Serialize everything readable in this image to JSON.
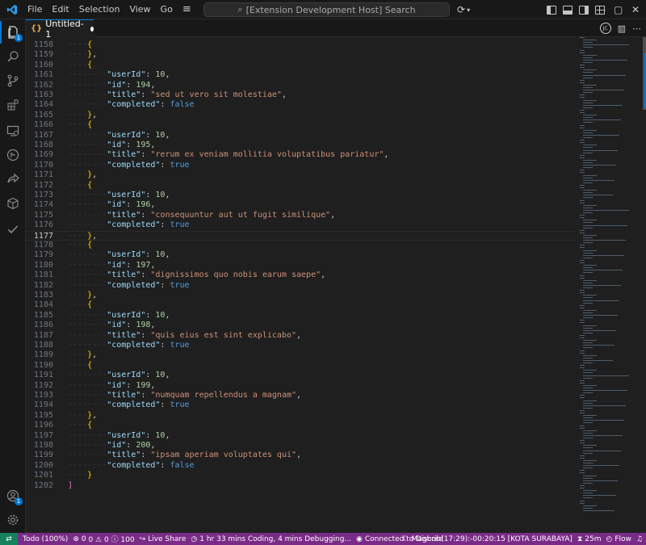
{
  "titlebar": {
    "menu": [
      "File",
      "Edit",
      "Selection",
      "View",
      "Go"
    ],
    "command_center": "[Extension Development Host] Search"
  },
  "activity_bar": {
    "items": [
      "explorer-icon",
      "search-icon",
      "source-control-icon",
      "extensions-icon",
      "remote-explorer-icon",
      "github-icon",
      "live-share-icon",
      "package-icon",
      "todo-check-icon"
    ],
    "explorer_badge": "1",
    "accounts_badge": "1"
  },
  "tab": {
    "label": "Untitled-1",
    "avatar_initials": "JC"
  },
  "editor": {
    "current_line": 1177,
    "lines": [
      {
        "n": "1158",
        "indent": 1,
        "tokens": [
          [
            "b2",
            "{"
          ]
        ]
      },
      {
        "n": "1159",
        "indent": 1,
        "tokens": [
          [
            "b2",
            "}"
          ],
          [
            "punc",
            ","
          ]
        ]
      },
      {
        "n": "1160",
        "indent": 1,
        "tokens": [
          [
            "b2",
            "{"
          ]
        ]
      },
      {
        "n": "1161",
        "indent": 2,
        "tokens": [
          [
            "key",
            "\"userId\""
          ],
          [
            "punc",
            ": "
          ],
          [
            "num",
            "10"
          ],
          [
            "punc",
            ","
          ]
        ]
      },
      {
        "n": "1162",
        "indent": 2,
        "tokens": [
          [
            "key",
            "\"id\""
          ],
          [
            "punc",
            ": "
          ],
          [
            "num",
            "194"
          ],
          [
            "punc",
            ","
          ]
        ]
      },
      {
        "n": "1163",
        "indent": 2,
        "tokens": [
          [
            "key",
            "\"title\""
          ],
          [
            "punc",
            ": "
          ],
          [
            "str",
            "\"sed ut vero sit molestiae\""
          ],
          [
            "punc",
            ","
          ]
        ]
      },
      {
        "n": "1164",
        "indent": 2,
        "tokens": [
          [
            "key",
            "\"completed\""
          ],
          [
            "punc",
            ": "
          ],
          [
            "kw",
            "false"
          ]
        ]
      },
      {
        "n": "1165",
        "indent": 1,
        "tokens": [
          [
            "b2",
            "}"
          ],
          [
            "punc",
            ","
          ]
        ]
      },
      {
        "n": "1166",
        "indent": 1,
        "tokens": [
          [
            "b2",
            "{"
          ]
        ]
      },
      {
        "n": "1167",
        "indent": 2,
        "tokens": [
          [
            "key",
            "\"userId\""
          ],
          [
            "punc",
            ": "
          ],
          [
            "num",
            "10"
          ],
          [
            "punc",
            ","
          ]
        ]
      },
      {
        "n": "1168",
        "indent": 2,
        "tokens": [
          [
            "key",
            "\"id\""
          ],
          [
            "punc",
            ": "
          ],
          [
            "num",
            "195"
          ],
          [
            "punc",
            ","
          ]
        ]
      },
      {
        "n": "1169",
        "indent": 2,
        "tokens": [
          [
            "key",
            "\"title\""
          ],
          [
            "punc",
            ": "
          ],
          [
            "str",
            "\"rerum ex veniam mollitia voluptatibus pariatur\""
          ],
          [
            "punc",
            ","
          ]
        ]
      },
      {
        "n": "1170",
        "indent": 2,
        "tokens": [
          [
            "key",
            "\"completed\""
          ],
          [
            "punc",
            ": "
          ],
          [
            "kw",
            "true"
          ]
        ]
      },
      {
        "n": "1171",
        "indent": 1,
        "tokens": [
          [
            "b2",
            "}"
          ],
          [
            "punc",
            ","
          ]
        ]
      },
      {
        "n": "1172",
        "indent": 1,
        "tokens": [
          [
            "b2",
            "{"
          ]
        ]
      },
      {
        "n": "1173",
        "indent": 2,
        "tokens": [
          [
            "key",
            "\"userId\""
          ],
          [
            "punc",
            ": "
          ],
          [
            "num",
            "10"
          ],
          [
            "punc",
            ","
          ]
        ]
      },
      {
        "n": "1174",
        "indent": 2,
        "tokens": [
          [
            "key",
            "\"id\""
          ],
          [
            "punc",
            ": "
          ],
          [
            "num",
            "196"
          ],
          [
            "punc",
            ","
          ]
        ]
      },
      {
        "n": "1175",
        "indent": 2,
        "tokens": [
          [
            "key",
            "\"title\""
          ],
          [
            "punc",
            ": "
          ],
          [
            "str",
            "\"consequuntur aut ut fugit similique\""
          ],
          [
            "punc",
            ","
          ]
        ]
      },
      {
        "n": "1176",
        "indent": 2,
        "tokens": [
          [
            "key",
            "\"completed\""
          ],
          [
            "punc",
            ": "
          ],
          [
            "kw",
            "true"
          ]
        ]
      },
      {
        "n": "1177",
        "indent": 1,
        "tokens": [
          [
            "b2",
            "}"
          ],
          [
            "punc",
            ","
          ]
        ]
      },
      {
        "n": "1178",
        "indent": 1,
        "tokens": [
          [
            "b2",
            "{"
          ]
        ]
      },
      {
        "n": "1179",
        "indent": 2,
        "tokens": [
          [
            "key",
            "\"userId\""
          ],
          [
            "punc",
            ": "
          ],
          [
            "num",
            "10"
          ],
          [
            "punc",
            ","
          ]
        ]
      },
      {
        "n": "1180",
        "indent": 2,
        "tokens": [
          [
            "key",
            "\"id\""
          ],
          [
            "punc",
            ": "
          ],
          [
            "num",
            "197"
          ],
          [
            "punc",
            ","
          ]
        ]
      },
      {
        "n": "1181",
        "indent": 2,
        "tokens": [
          [
            "key",
            "\"title\""
          ],
          [
            "punc",
            ": "
          ],
          [
            "str",
            "\"dignissimos quo nobis earum saepe\""
          ],
          [
            "punc",
            ","
          ]
        ]
      },
      {
        "n": "1182",
        "indent": 2,
        "tokens": [
          [
            "key",
            "\"completed\""
          ],
          [
            "punc",
            ": "
          ],
          [
            "kw",
            "true"
          ]
        ]
      },
      {
        "n": "1183",
        "indent": 1,
        "tokens": [
          [
            "b2",
            "}"
          ],
          [
            "punc",
            ","
          ]
        ]
      },
      {
        "n": "1184",
        "indent": 1,
        "tokens": [
          [
            "b2",
            "{"
          ]
        ]
      },
      {
        "n": "1185",
        "indent": 2,
        "tokens": [
          [
            "key",
            "\"userId\""
          ],
          [
            "punc",
            ": "
          ],
          [
            "num",
            "10"
          ],
          [
            "punc",
            ","
          ]
        ]
      },
      {
        "n": "1186",
        "indent": 2,
        "tokens": [
          [
            "key",
            "\"id\""
          ],
          [
            "punc",
            ": "
          ],
          [
            "num",
            "198"
          ],
          [
            "punc",
            ","
          ]
        ]
      },
      {
        "n": "1187",
        "indent": 2,
        "tokens": [
          [
            "key",
            "\"title\""
          ],
          [
            "punc",
            ": "
          ],
          [
            "str",
            "\"quis eius est sint explicabo\""
          ],
          [
            "punc",
            ","
          ]
        ]
      },
      {
        "n": "1188",
        "indent": 2,
        "tokens": [
          [
            "key",
            "\"completed\""
          ],
          [
            "punc",
            ": "
          ],
          [
            "kw",
            "true"
          ]
        ]
      },
      {
        "n": "1189",
        "indent": 1,
        "tokens": [
          [
            "b2",
            "}"
          ],
          [
            "punc",
            ","
          ]
        ]
      },
      {
        "n": "1190",
        "indent": 1,
        "tokens": [
          [
            "b2",
            "{"
          ]
        ]
      },
      {
        "n": "1191",
        "indent": 2,
        "tokens": [
          [
            "key",
            "\"userId\""
          ],
          [
            "punc",
            ": "
          ],
          [
            "num",
            "10"
          ],
          [
            "punc",
            ","
          ]
        ]
      },
      {
        "n": "1192",
        "indent": 2,
        "tokens": [
          [
            "key",
            "\"id\""
          ],
          [
            "punc",
            ": "
          ],
          [
            "num",
            "199"
          ],
          [
            "punc",
            ","
          ]
        ]
      },
      {
        "n": "1193",
        "indent": 2,
        "tokens": [
          [
            "key",
            "\"title\""
          ],
          [
            "punc",
            ": "
          ],
          [
            "str",
            "\"numquam repellendus a magnam\""
          ],
          [
            "punc",
            ","
          ]
        ]
      },
      {
        "n": "1194",
        "indent": 2,
        "tokens": [
          [
            "key",
            "\"completed\""
          ],
          [
            "punc",
            ": "
          ],
          [
            "kw",
            "true"
          ]
        ]
      },
      {
        "n": "1195",
        "indent": 1,
        "tokens": [
          [
            "b2",
            "}"
          ],
          [
            "punc",
            ","
          ]
        ]
      },
      {
        "n": "1196",
        "indent": 1,
        "tokens": [
          [
            "b2",
            "{"
          ]
        ]
      },
      {
        "n": "1197",
        "indent": 2,
        "tokens": [
          [
            "key",
            "\"userId\""
          ],
          [
            "punc",
            ": "
          ],
          [
            "num",
            "10"
          ],
          [
            "punc",
            ","
          ]
        ]
      },
      {
        "n": "1198",
        "indent": 2,
        "tokens": [
          [
            "key",
            "\"id\""
          ],
          [
            "punc",
            ": "
          ],
          [
            "num",
            "200"
          ],
          [
            "punc",
            ","
          ]
        ]
      },
      {
        "n": "1199",
        "indent": 2,
        "tokens": [
          [
            "key",
            "\"title\""
          ],
          [
            "punc",
            ": "
          ],
          [
            "str",
            "\"ipsam aperiam voluptates qui\""
          ],
          [
            "punc",
            ","
          ]
        ]
      },
      {
        "n": "1200",
        "indent": 2,
        "tokens": [
          [
            "key",
            "\"completed\""
          ],
          [
            "punc",
            ": "
          ],
          [
            "kw",
            "false"
          ]
        ]
      },
      {
        "n": "1201",
        "indent": 1,
        "tokens": [
          [
            "b2",
            "}"
          ]
        ]
      },
      {
        "n": "1202",
        "indent": 0,
        "tokens": [
          [
            "b1",
            "]"
          ]
        ]
      }
    ]
  },
  "statusbar": {
    "todo": "Todo (100%)",
    "problems": "0 ⚠ 0 ⓘ 100",
    "errors_count": "0",
    "live_share": "Live Share",
    "coding_time": "1 hr 33 mins Coding, 4 mins Debugging...",
    "discord": "Connected to Discord",
    "prayer": "Maghrib(17:29):-00:20:15 [KOTA SURABAYA]",
    "timer": "25m",
    "flow": "Flow"
  },
  "colors": {
    "accent": "#0078d4",
    "statusbar": "#7a2b87",
    "remote": "#16825d"
  }
}
